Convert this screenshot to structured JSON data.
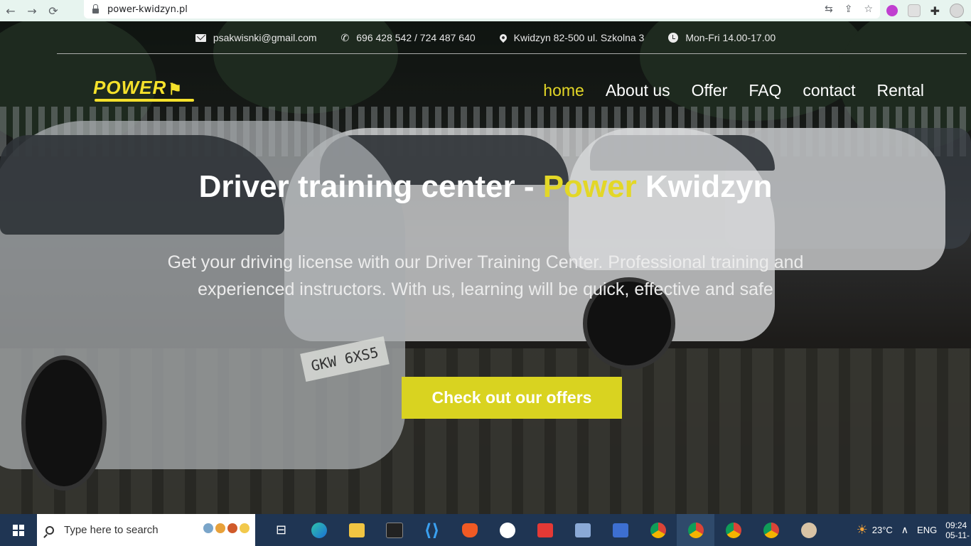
{
  "browser": {
    "url": "power-kwidzyn.pl"
  },
  "info_bar": {
    "email": "psakwisnki@gmail.com",
    "phone": "696 428 542 / 724 487 640",
    "address": "Kwidzyn 82-500 ul. Szkolna 3",
    "hours": "Mon-Fri 14.00-17.00"
  },
  "logo": {
    "text": "POWER"
  },
  "nav": {
    "items": [
      "home",
      "About us",
      "Offer",
      "FAQ",
      "contact",
      "Rental"
    ],
    "active": "home"
  },
  "hero": {
    "title_main": "Driver training center - ",
    "title_accent": "Power",
    "title_end": " Kwidzyn",
    "description": "Get your driving license with our Driver Training Center. Professional training and experienced instructors. With us, learning will be quick, effective and safe",
    "cta_label": "Check out our offers",
    "plate_text": "GKW 6XS5"
  },
  "taskbar": {
    "search_placeholder": "Type here to search",
    "temperature": "23°C",
    "language": "ENG",
    "time": "09:24",
    "date": "05-11-"
  },
  "colors": {
    "accent_yellow": "#e3d727",
    "button_yellow": "#d9d320",
    "taskbar": "#1f3553",
    "browser_bar": "#e7f4ef"
  }
}
